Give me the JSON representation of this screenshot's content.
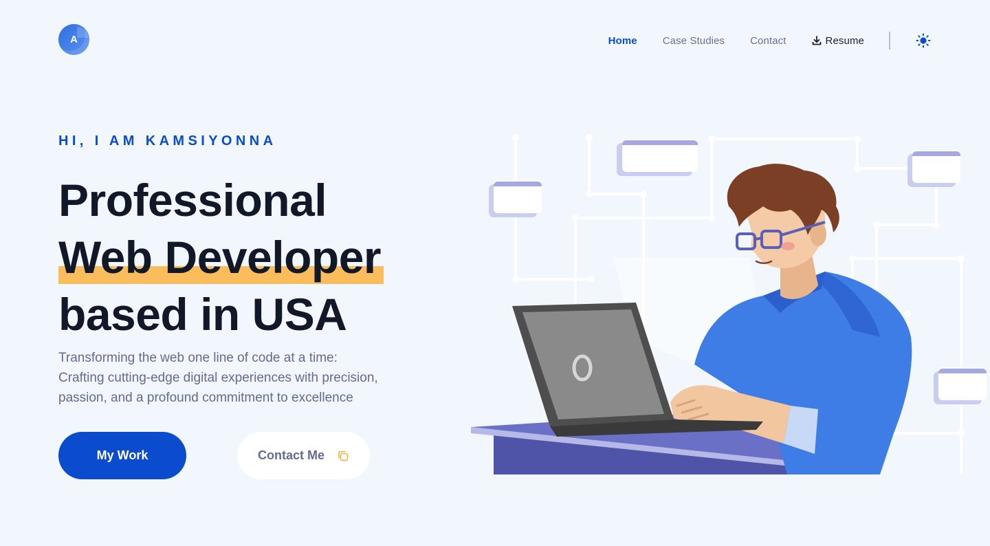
{
  "header": {
    "logo_letter": "A",
    "nav": {
      "home": "Home",
      "case_studies": "Case Studies",
      "contact": "Contact",
      "resume": "Resume"
    },
    "download_icon": "download-icon",
    "theme_icon": "sun-icon"
  },
  "hero": {
    "eyebrow": "HI, I AM KAMSIYONNA",
    "headline_line1": "Professional",
    "headline_line2": "Web Developer",
    "headline_line3": "based in USA",
    "sub_line1": "Transforming the web one line of code at a time:",
    "sub_line2": "Crafting cutting-edge digital experiences with precision,",
    "sub_line3": "passion, and a profound commitment to excellence",
    "primary_button": "My Work",
    "secondary_button": "Contact Me",
    "secondary_icon": "copy-icon"
  },
  "colors": {
    "background": "#f2f7fe",
    "accent": "#0b4ccf",
    "highlight": "#fbbd5c",
    "text": "#111827",
    "muted": "#646b93"
  }
}
